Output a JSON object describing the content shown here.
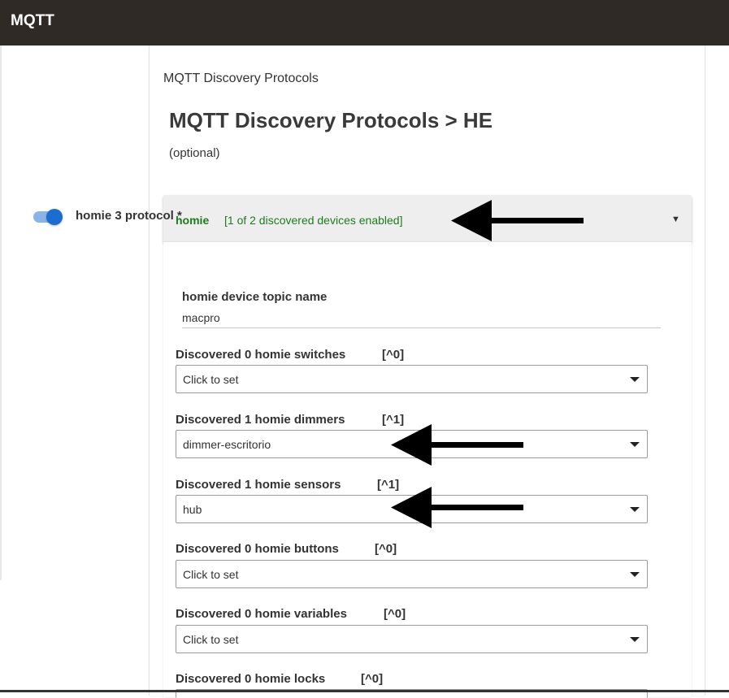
{
  "app": {
    "title": "MQTT"
  },
  "page": {
    "breadcrumb": "MQTT Discovery Protocols",
    "title": "MQTT Discovery Protocols > HE",
    "optional": "(optional)"
  },
  "section": {
    "name": "homie",
    "summary": "[1 of 2 discovered devices enabled]",
    "chevron": "▼",
    "protocol_toggle": {
      "label": "homie 3 protocol *",
      "enabled": true
    },
    "topic_field": {
      "label": "homie device topic name",
      "value": "macpro"
    },
    "devices": [
      {
        "label": "Discovered 0 homie switches",
        "count": "[^0]",
        "value": "Click to set"
      },
      {
        "label": "Discovered 1 homie dimmers",
        "count": "[^1]",
        "value": "dimmer-escritorio"
      },
      {
        "label": "Discovered 1 homie sensors",
        "count": "[^1]",
        "value": "hub"
      },
      {
        "label": "Discovered 0 homie buttons",
        "count": "[^0]",
        "value": "Click to set"
      },
      {
        "label": "Discovered 0 homie variables",
        "count": "[^0]",
        "value": "Click to set"
      },
      {
        "label": "Discovered 0 homie locks",
        "count": "[^0]",
        "value": ""
      }
    ]
  },
  "colors": {
    "topbar": "#302a27",
    "accent_green": "#1f7a1f",
    "toggle_blue": "#1b6ed1"
  }
}
